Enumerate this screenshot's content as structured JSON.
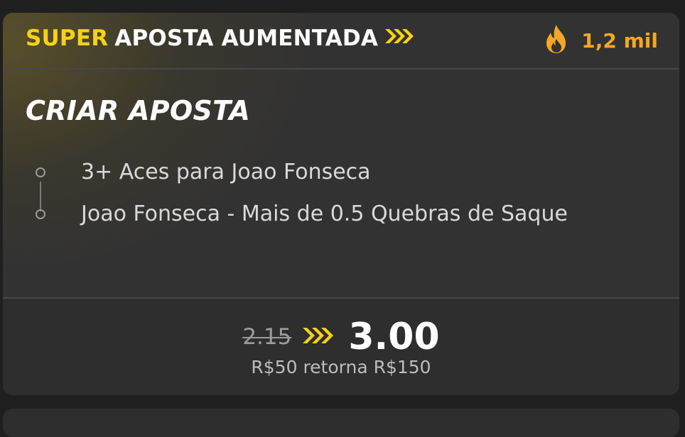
{
  "header": {
    "super_label": "SUPER",
    "title_rest": "APOSTA AUMENTADA",
    "popularity_count": "1,2 mil",
    "chevron_icon": "triple-chevron-right-icon",
    "fire_icon": "fire-icon"
  },
  "bet": {
    "title": "CRIAR APOSTA",
    "legs": [
      {
        "label": "3+ Aces para Joao Fonseca"
      },
      {
        "label": "Joao Fonseca - Mais de 0.5 Quebras de Saque"
      }
    ]
  },
  "odds": {
    "old": "2.15",
    "new": "3.00",
    "returns_text": "R$50 retorna R$150"
  },
  "colors": {
    "accent_yellow": "#f7d117",
    "fire_orange": "#f5a623",
    "card_bg": "#323232"
  }
}
